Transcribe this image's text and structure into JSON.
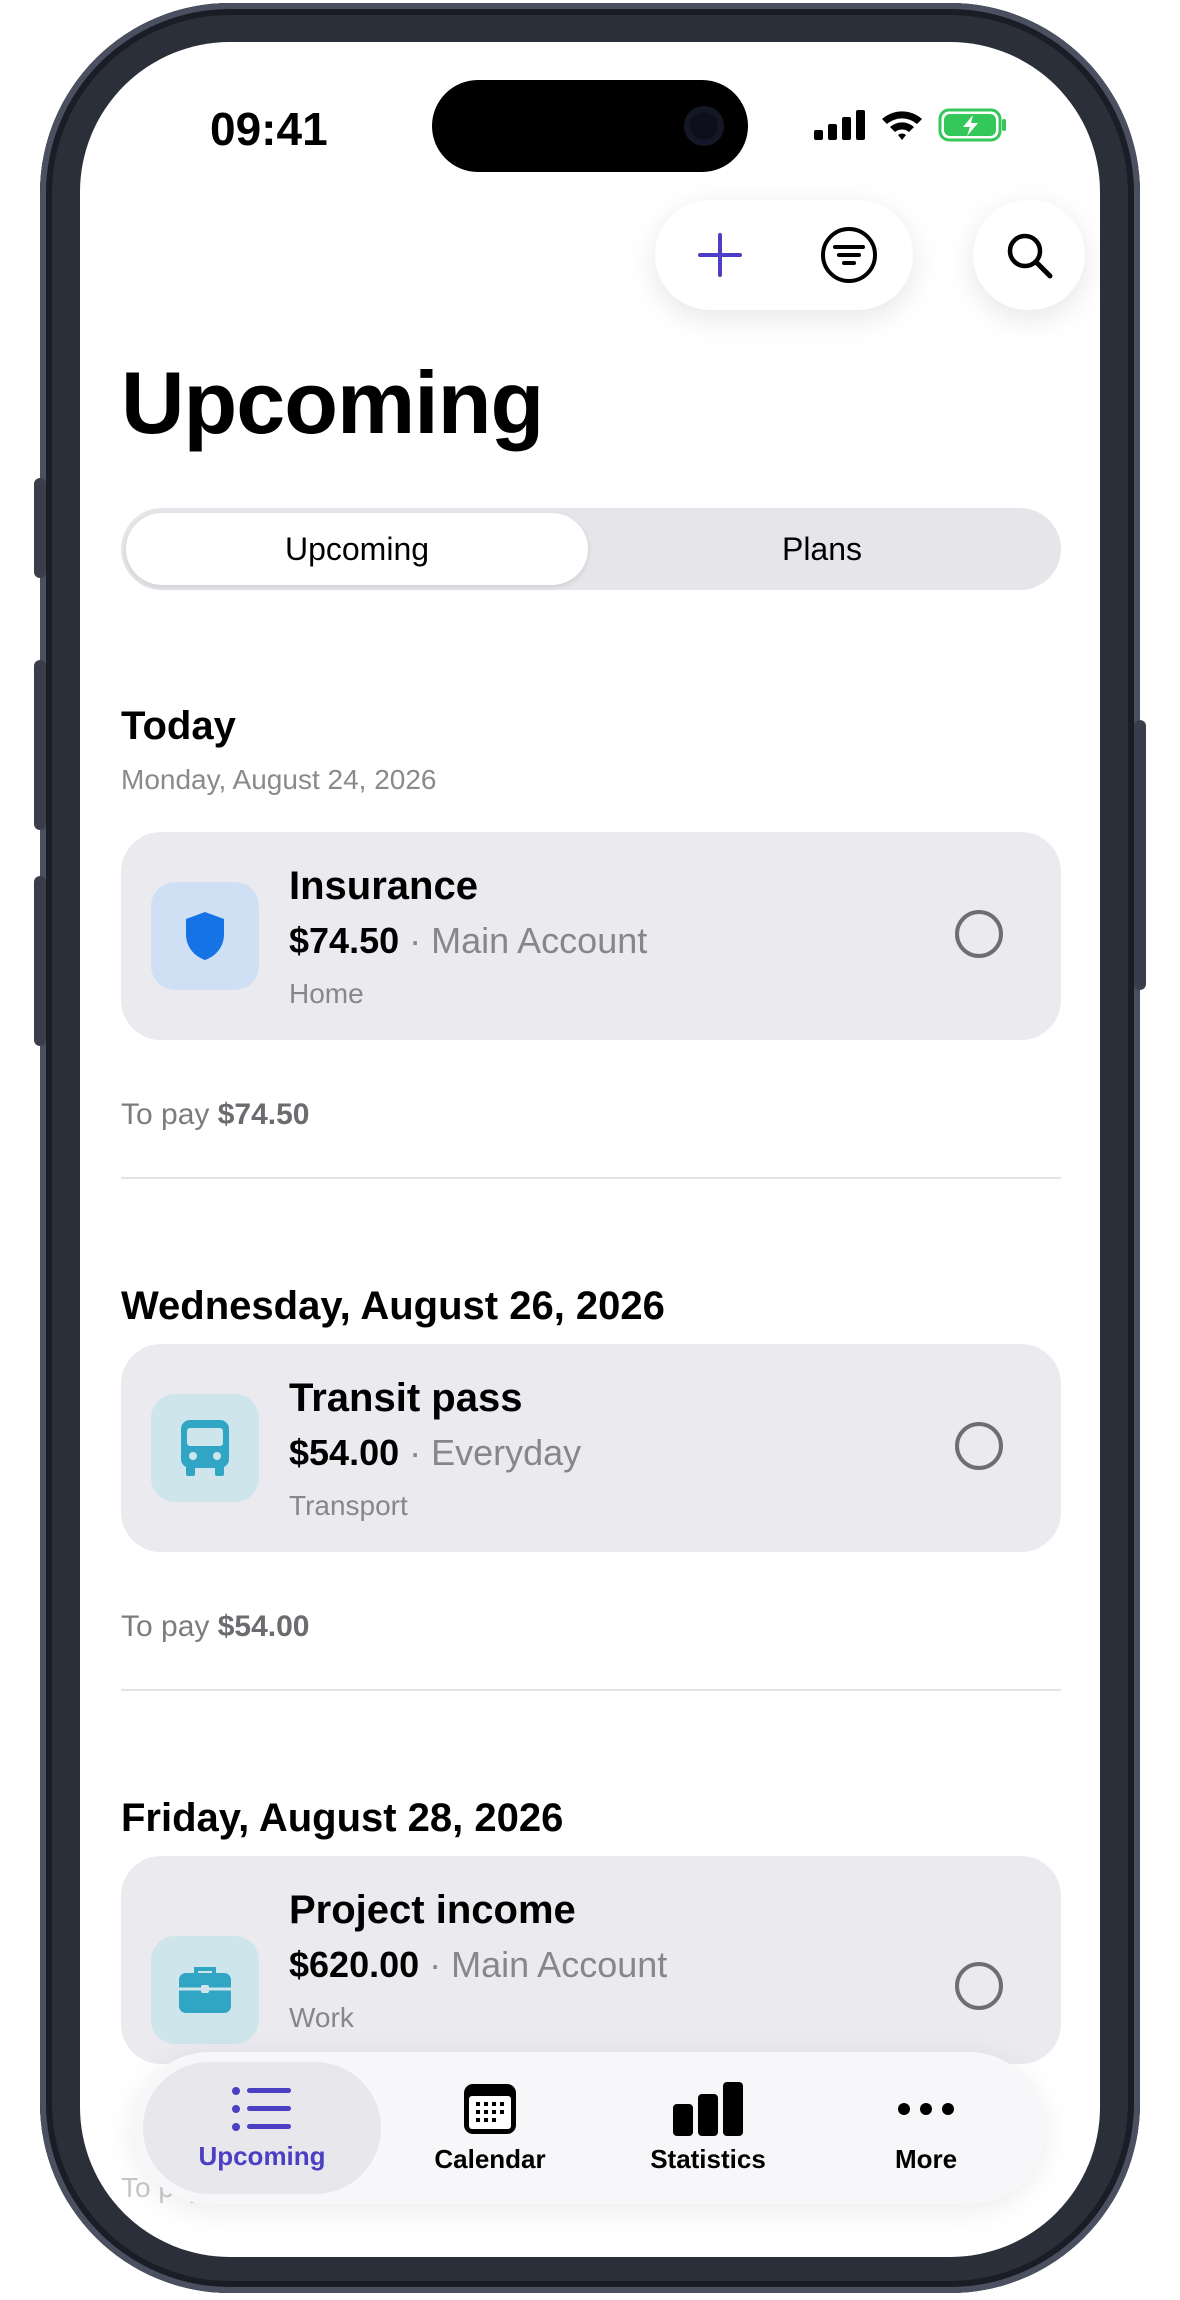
{
  "status_bar": {
    "time": "09:41"
  },
  "header": {
    "title": "Upcoming"
  },
  "actions": {
    "add_icon": "plus-icon",
    "filter_icon": "filter-icon",
    "search_icon": "search-icon"
  },
  "segmented": {
    "options": [
      "Upcoming",
      "Plans"
    ],
    "selected": "Upcoming"
  },
  "sections": [
    {
      "title": "Today",
      "subtitle": "Monday, August 24, 2026",
      "item": {
        "name": "Insurance",
        "amount": "$74.50",
        "separator": " · ",
        "account": "Main Account",
        "category": "Home",
        "icon": "shield-icon",
        "icon_color": "#1673e6",
        "icon_bg": "#cfe0f5"
      },
      "to_pay_label": "To pay",
      "to_pay_value": "$74.50"
    },
    {
      "title": "Wednesday, August 26, 2026",
      "item": {
        "name": "Transit pass",
        "amount": "$54.00",
        "separator": " · ",
        "account": "Everyday",
        "category": "Transport",
        "icon": "bus-icon",
        "icon_color": "#31a6c4",
        "icon_bg": "#cfe5ec"
      },
      "to_pay_label": "To pay",
      "to_pay_value": "$54.00"
    },
    {
      "title": "Friday, August 28, 2026",
      "item": {
        "name": "Project income",
        "amount": "$620.00",
        "separator": " · ",
        "account": "Main Account",
        "category": "Work",
        "icon": "briefcase-icon",
        "icon_color": "#31a6c4",
        "icon_bg": "#cfe5ec"
      },
      "to_pay_label": "To pay"
    }
  ],
  "tab_bar": {
    "tabs": [
      {
        "label": "Upcoming",
        "icon": "list-icon",
        "active": true
      },
      {
        "label": "Calendar",
        "icon": "calendar-icon",
        "active": false
      },
      {
        "label": "Statistics",
        "icon": "bar-chart-icon",
        "active": false
      },
      {
        "label": "More",
        "icon": "more-icon",
        "active": false
      }
    ]
  },
  "colors": {
    "accent": "#4b3fc4",
    "card_bg": "#ebebef",
    "battery_green": "#34c759"
  }
}
